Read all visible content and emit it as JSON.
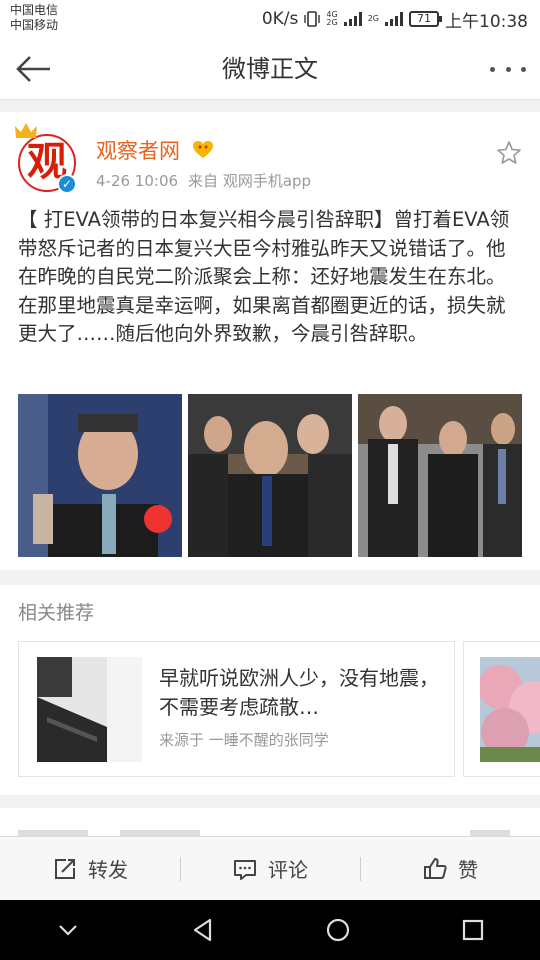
{
  "status_bar": {
    "carrier1": "中国电信",
    "carrier2": "中国移动",
    "speed": "0K/s",
    "net1": "4G",
    "net1_sub": "2G",
    "net2": "2G",
    "battery": "71",
    "time": "上午10:38"
  },
  "nav": {
    "back_icon": "arrow-left-icon",
    "title": "微博正文",
    "more_icon": "more-dots-icon"
  },
  "post": {
    "avatar_text": "观",
    "username": "观察者网",
    "time": "4-26 10:06",
    "source": "来自 观网手机app",
    "text": "【 打EVA领带的日本复兴相今晨引咎辞职】曾打着EVA领带怒斥记者的日本复兴大臣今村雅弘昨天又说错话了。他在昨晚的自民党二阶派聚会上称：还好地震发生在东北。在那里地震真是幸运啊，如果离首都圈更近的话，损失就更大了……随后他向外界致歉，今晨引咎辞职。"
  },
  "related": {
    "section_title": "相关推荐",
    "card1_title": "早就听说欧洲人少，没有地震，不需要考虑疏散…",
    "card1_source": "来源于 一睡不醒的张同学"
  },
  "actions": {
    "repost": "转发",
    "comment": "评论",
    "like": "赞"
  },
  "colors": {
    "username": "#e8641e",
    "verify": "#1a8cd8",
    "brand_red": "#d81e06"
  }
}
